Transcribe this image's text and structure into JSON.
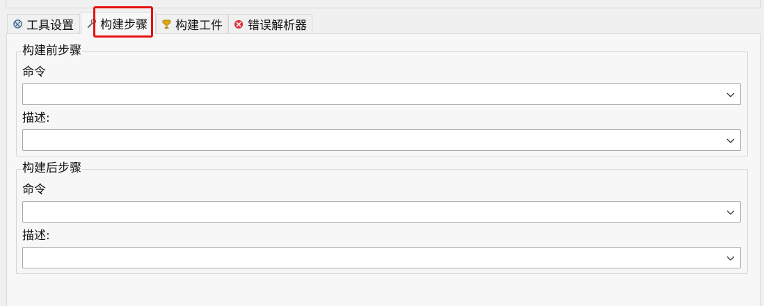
{
  "tabs": [
    {
      "label": "工具设置",
      "icon": "gear-icon",
      "active": false
    },
    {
      "label": "构建步骤",
      "icon": "wrench-icon",
      "active": true
    },
    {
      "label": "构建工件",
      "icon": "trophy-icon",
      "active": false
    },
    {
      "label": "错误解析器",
      "icon": "error-icon",
      "active": false
    }
  ],
  "pre_build": {
    "title": "构建前步骤",
    "command_label": "命令",
    "command_value": "",
    "description_label": "描述:",
    "description_value": ""
  },
  "post_build": {
    "title": "构建后步骤",
    "command_label": "命令",
    "command_value": "",
    "description_label": "描述:",
    "description_value": ""
  },
  "colors": {
    "highlight": "#e51010",
    "panel_bg": "#f7f7f7",
    "window_bg": "#f0f0f0",
    "error_icon": "#d9363e",
    "trophy_icon": "#e0a800"
  }
}
